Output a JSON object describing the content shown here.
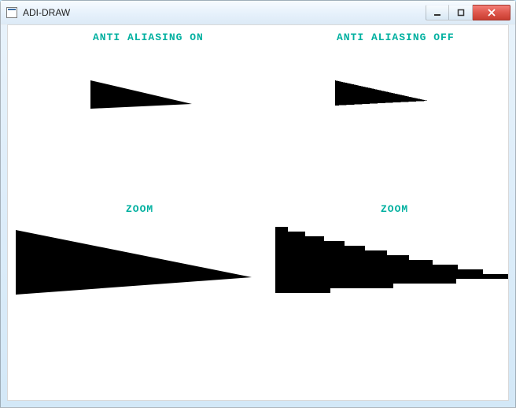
{
  "window": {
    "title": "ADI-DRAW"
  },
  "labels": {
    "aa_on": "ANTI ALIASING ON",
    "aa_off": "ANTI ALIASING OFF",
    "zoom_left": "ZOOM",
    "zoom_right": "ZOOM"
  },
  "colors": {
    "label_color": "#00b0a0",
    "shape_color": "#000000",
    "client_bg": "#ffffff",
    "chrome_bg": "#dceaf6",
    "close_red": "#d9483b"
  },
  "png_b64": ""
}
